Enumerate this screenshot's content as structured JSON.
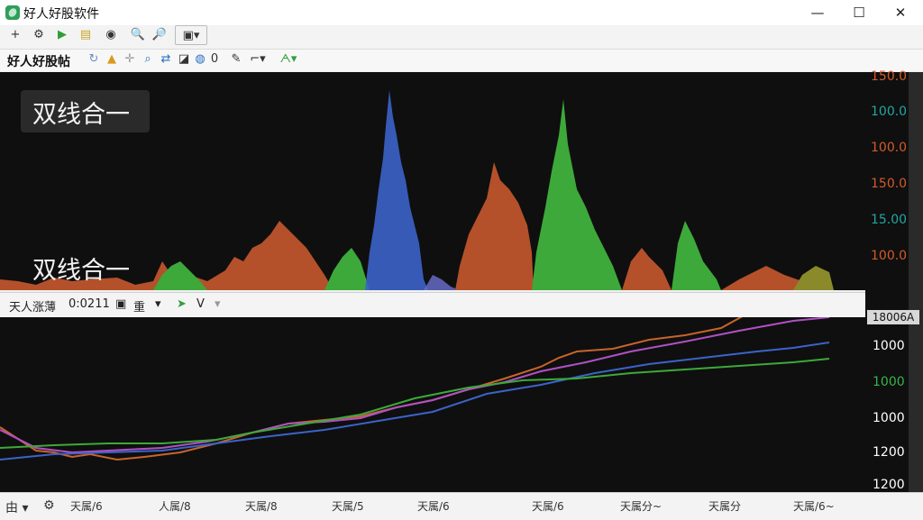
{
  "window": {
    "title": "好人好股软件",
    "controls": {
      "minimize": "—",
      "maximize": "☐",
      "close": "✕"
    }
  },
  "toolbar1": {
    "buttons": [
      "+",
      "⚙",
      "▶",
      "▤",
      "◉",
      "🔍",
      "🔎",
      "▣▾"
    ]
  },
  "toolbar2": {
    "label": "好人好股帖",
    "zoom_value": "0",
    "icons": [
      "refresh-icon",
      "lock-icon",
      "crosshair-icon",
      "zoom-icon",
      "pan-icon",
      "chart-icon",
      "draw-icon",
      "mode-icon",
      "text-icon"
    ]
  },
  "upper_chart": {
    "overlay_title": "双线合一",
    "overlay_subtitle": "双线合一",
    "right_axis_labels": [
      "150.0",
      "100.0",
      "100.0",
      "150.0",
      "15.00",
      "100.0"
    ],
    "right_axis_colors": [
      "#d45a2b",
      "#21a7a2",
      "#d45a2b",
      "#d45a2b",
      "#21a7a2",
      "#d45a2b"
    ]
  },
  "mid_toolbar": {
    "label": "天人涨薄",
    "time": "0:0211",
    "doc_label": "重",
    "arrow_label": "V"
  },
  "lower_chart": {
    "badge": "18006A",
    "right_axis_labels": [
      "1000",
      "1000",
      "1000",
      "1200",
      "1200"
    ],
    "right_axis_colors": [
      "#ffffff",
      "#36b54a",
      "#ffffff",
      "#ffffff",
      "#ffffff"
    ]
  },
  "bottom_bar": {
    "x_labels": [
      "天属/6",
      "人属/8",
      "天属/8",
      "天属/5",
      "天属/6",
      "天属/6",
      "天属分~",
      "天属分",
      "天属/6~"
    ]
  },
  "colors": {
    "blue": "#3b63c9",
    "orange": "#c8642c",
    "green": "#3da93a",
    "purple": "#b051c4",
    "brown": "#a0462a"
  }
}
